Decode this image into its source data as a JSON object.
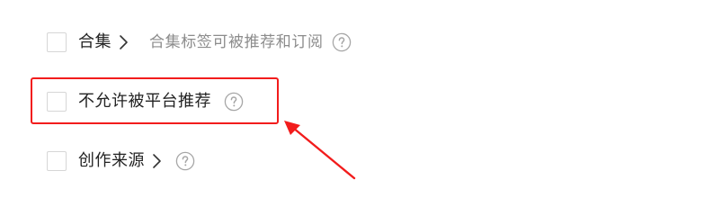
{
  "options": [
    {
      "label": "合集",
      "has_chevron": true,
      "description": "合集标签可被推荐和订阅",
      "checked": false,
      "icon_help": "question-circle-icon",
      "icon_chevron": "chevron-right-icon"
    },
    {
      "label": "不允许被平台推荐",
      "has_chevron": false,
      "checked": false,
      "icon_help": "question-circle-icon"
    },
    {
      "label": "创作来源",
      "has_chevron": true,
      "checked": false,
      "icon_help": "question-circle-icon",
      "icon_chevron": "chevron-right-icon"
    }
  ],
  "annotation": {
    "color": "#f21c1c",
    "highlighted_option": "不允许被平台推荐"
  },
  "colors": {
    "label_text": "#222222",
    "description_text": "#8c8c8c",
    "checkbox_border": "#d6d6d6",
    "icon_gray": "#a6a6a6"
  }
}
